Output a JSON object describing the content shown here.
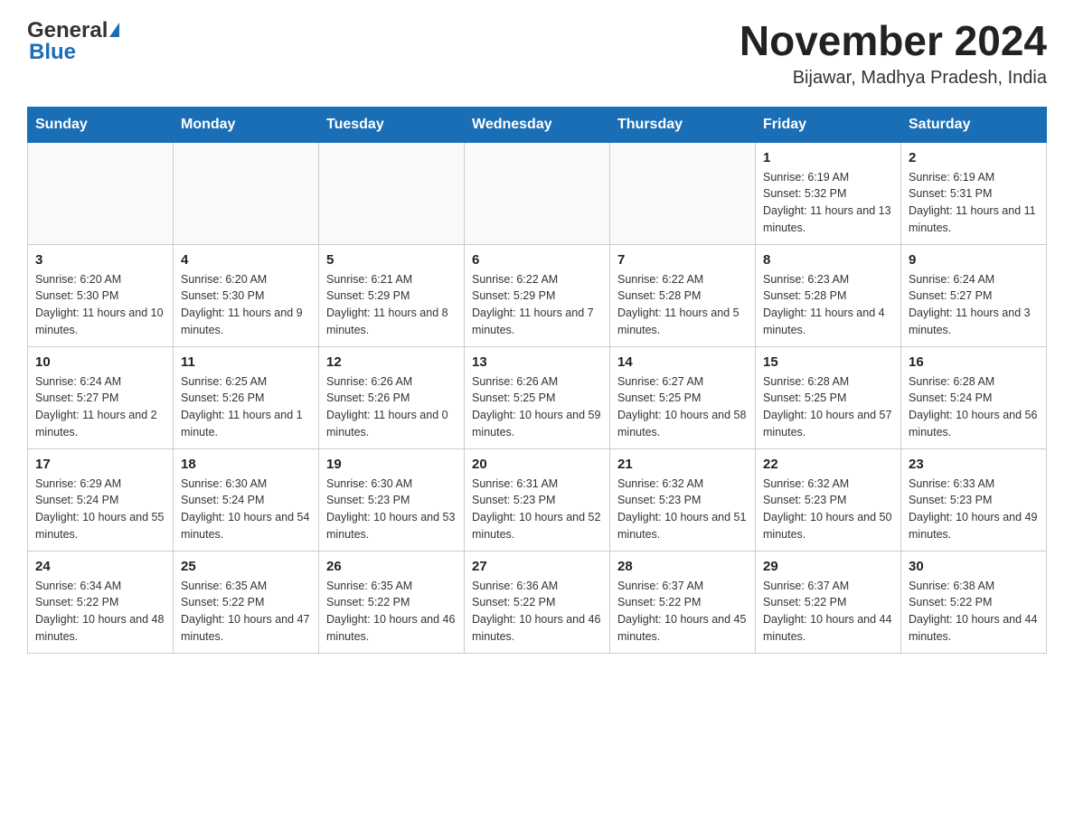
{
  "header": {
    "logo_general": "General",
    "logo_blue": "Blue",
    "title": "November 2024",
    "subtitle": "Bijawar, Madhya Pradesh, India"
  },
  "days_of_week": [
    "Sunday",
    "Monday",
    "Tuesday",
    "Wednesday",
    "Thursday",
    "Friday",
    "Saturday"
  ],
  "weeks": [
    [
      {
        "day": "",
        "info": ""
      },
      {
        "day": "",
        "info": ""
      },
      {
        "day": "",
        "info": ""
      },
      {
        "day": "",
        "info": ""
      },
      {
        "day": "",
        "info": ""
      },
      {
        "day": "1",
        "info": "Sunrise: 6:19 AM\nSunset: 5:32 PM\nDaylight: 11 hours and 13 minutes."
      },
      {
        "day": "2",
        "info": "Sunrise: 6:19 AM\nSunset: 5:31 PM\nDaylight: 11 hours and 11 minutes."
      }
    ],
    [
      {
        "day": "3",
        "info": "Sunrise: 6:20 AM\nSunset: 5:30 PM\nDaylight: 11 hours and 10 minutes."
      },
      {
        "day": "4",
        "info": "Sunrise: 6:20 AM\nSunset: 5:30 PM\nDaylight: 11 hours and 9 minutes."
      },
      {
        "day": "5",
        "info": "Sunrise: 6:21 AM\nSunset: 5:29 PM\nDaylight: 11 hours and 8 minutes."
      },
      {
        "day": "6",
        "info": "Sunrise: 6:22 AM\nSunset: 5:29 PM\nDaylight: 11 hours and 7 minutes."
      },
      {
        "day": "7",
        "info": "Sunrise: 6:22 AM\nSunset: 5:28 PM\nDaylight: 11 hours and 5 minutes."
      },
      {
        "day": "8",
        "info": "Sunrise: 6:23 AM\nSunset: 5:28 PM\nDaylight: 11 hours and 4 minutes."
      },
      {
        "day": "9",
        "info": "Sunrise: 6:24 AM\nSunset: 5:27 PM\nDaylight: 11 hours and 3 minutes."
      }
    ],
    [
      {
        "day": "10",
        "info": "Sunrise: 6:24 AM\nSunset: 5:27 PM\nDaylight: 11 hours and 2 minutes."
      },
      {
        "day": "11",
        "info": "Sunrise: 6:25 AM\nSunset: 5:26 PM\nDaylight: 11 hours and 1 minute."
      },
      {
        "day": "12",
        "info": "Sunrise: 6:26 AM\nSunset: 5:26 PM\nDaylight: 11 hours and 0 minutes."
      },
      {
        "day": "13",
        "info": "Sunrise: 6:26 AM\nSunset: 5:25 PM\nDaylight: 10 hours and 59 minutes."
      },
      {
        "day": "14",
        "info": "Sunrise: 6:27 AM\nSunset: 5:25 PM\nDaylight: 10 hours and 58 minutes."
      },
      {
        "day": "15",
        "info": "Sunrise: 6:28 AM\nSunset: 5:25 PM\nDaylight: 10 hours and 57 minutes."
      },
      {
        "day": "16",
        "info": "Sunrise: 6:28 AM\nSunset: 5:24 PM\nDaylight: 10 hours and 56 minutes."
      }
    ],
    [
      {
        "day": "17",
        "info": "Sunrise: 6:29 AM\nSunset: 5:24 PM\nDaylight: 10 hours and 55 minutes."
      },
      {
        "day": "18",
        "info": "Sunrise: 6:30 AM\nSunset: 5:24 PM\nDaylight: 10 hours and 54 minutes."
      },
      {
        "day": "19",
        "info": "Sunrise: 6:30 AM\nSunset: 5:23 PM\nDaylight: 10 hours and 53 minutes."
      },
      {
        "day": "20",
        "info": "Sunrise: 6:31 AM\nSunset: 5:23 PM\nDaylight: 10 hours and 52 minutes."
      },
      {
        "day": "21",
        "info": "Sunrise: 6:32 AM\nSunset: 5:23 PM\nDaylight: 10 hours and 51 minutes."
      },
      {
        "day": "22",
        "info": "Sunrise: 6:32 AM\nSunset: 5:23 PM\nDaylight: 10 hours and 50 minutes."
      },
      {
        "day": "23",
        "info": "Sunrise: 6:33 AM\nSunset: 5:23 PM\nDaylight: 10 hours and 49 minutes."
      }
    ],
    [
      {
        "day": "24",
        "info": "Sunrise: 6:34 AM\nSunset: 5:22 PM\nDaylight: 10 hours and 48 minutes."
      },
      {
        "day": "25",
        "info": "Sunrise: 6:35 AM\nSunset: 5:22 PM\nDaylight: 10 hours and 47 minutes."
      },
      {
        "day": "26",
        "info": "Sunrise: 6:35 AM\nSunset: 5:22 PM\nDaylight: 10 hours and 46 minutes."
      },
      {
        "day": "27",
        "info": "Sunrise: 6:36 AM\nSunset: 5:22 PM\nDaylight: 10 hours and 46 minutes."
      },
      {
        "day": "28",
        "info": "Sunrise: 6:37 AM\nSunset: 5:22 PM\nDaylight: 10 hours and 45 minutes."
      },
      {
        "day": "29",
        "info": "Sunrise: 6:37 AM\nSunset: 5:22 PM\nDaylight: 10 hours and 44 minutes."
      },
      {
        "day": "30",
        "info": "Sunrise: 6:38 AM\nSunset: 5:22 PM\nDaylight: 10 hours and 44 minutes."
      }
    ]
  ]
}
